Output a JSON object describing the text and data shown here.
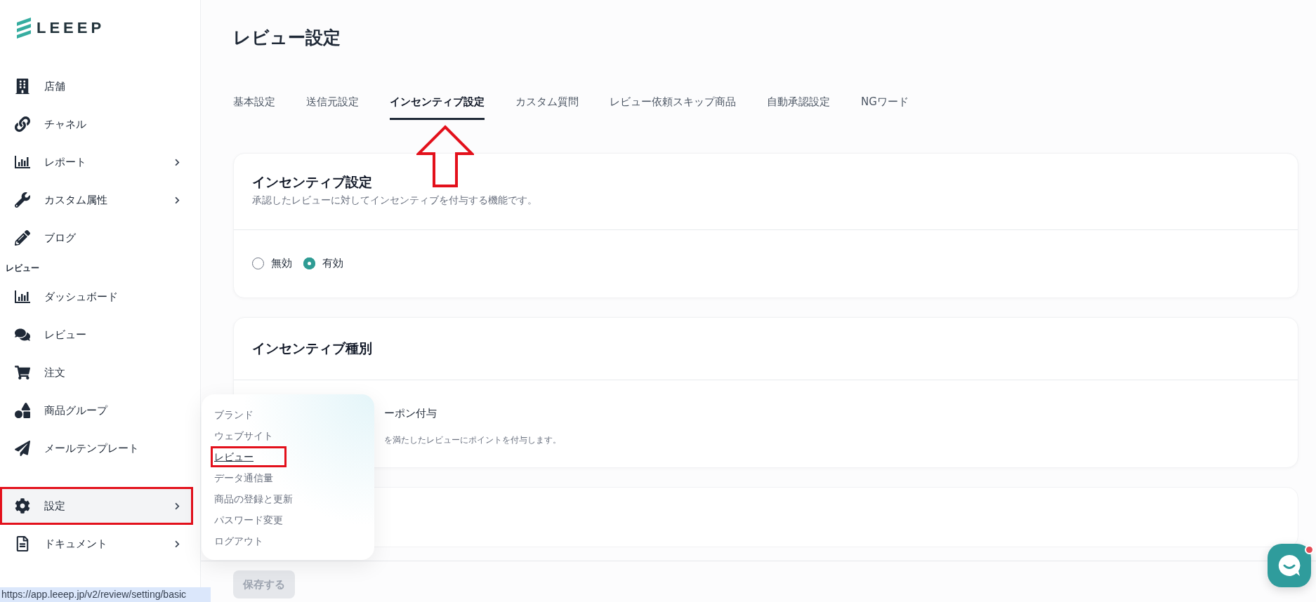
{
  "logo": {
    "text": "LEEEP"
  },
  "sidebar": {
    "items": [
      {
        "label": "店舗",
        "submenu": false,
        "selected": false,
        "marked": false
      },
      {
        "label": "チャネル",
        "submenu": false,
        "selected": false,
        "marked": false
      },
      {
        "label": "レポート",
        "submenu": true,
        "selected": false,
        "marked": false
      },
      {
        "label": "カスタム属性",
        "submenu": true,
        "selected": false,
        "marked": false
      },
      {
        "label": "ブログ",
        "submenu": false,
        "selected": false,
        "marked": false
      }
    ],
    "section_label": "レビュー",
    "review_items": [
      {
        "label": "ダッシュボード",
        "submenu": false,
        "selected": false,
        "marked": false
      },
      {
        "label": "レビュー",
        "submenu": false,
        "selected": false,
        "marked": false
      },
      {
        "label": "注文",
        "submenu": false,
        "selected": false,
        "marked": false
      },
      {
        "label": "商品グループ",
        "submenu": false,
        "selected": false,
        "marked": false
      },
      {
        "label": "メールテンプレート",
        "submenu": false,
        "selected": false,
        "marked": false
      }
    ],
    "bottom_items": [
      {
        "label": "設定",
        "submenu": true,
        "selected": true,
        "marked": true
      },
      {
        "label": "ドキュメント",
        "submenu": true,
        "selected": false,
        "marked": false
      }
    ]
  },
  "page_title": "レビュー設定",
  "tabs": [
    {
      "label": "基本設定",
      "selected": false
    },
    {
      "label": "送信元設定",
      "selected": false
    },
    {
      "label": "インセンティブ設定",
      "selected": true
    },
    {
      "label": "カスタム質問",
      "selected": false
    },
    {
      "label": "レビュー依頼スキップ商品",
      "selected": false
    },
    {
      "label": "自動承認設定",
      "selected": false
    },
    {
      "label": "NGワード",
      "selected": false
    }
  ],
  "incentive_card": {
    "title": "インセンティブ設定",
    "description": "承認したレビューに対してインセンティブを付与する機能です。",
    "options": [
      {
        "label": "無効",
        "selected": false
      },
      {
        "label": "有効",
        "selected": true
      }
    ]
  },
  "type_card": {
    "title": "インセンティブ種別",
    "option_label": "ーポン付与",
    "option_description": "を満たしたレビューにポイントを付与します。"
  },
  "save_button": {
    "label": "保存する",
    "disabled": true
  },
  "settings_menu": {
    "items": [
      {
        "label": "ブランド",
        "selected": false,
        "marked": false
      },
      {
        "label": "ウェブサイト",
        "selected": false,
        "marked": false
      },
      {
        "label": "レビュー",
        "selected": true,
        "marked": true
      },
      {
        "label": "データ通信量",
        "selected": false,
        "marked": false
      },
      {
        "label": "商品の登録と更新",
        "selected": false,
        "marked": false
      },
      {
        "label": "パスワード変更",
        "selected": false,
        "marked": false
      },
      {
        "label": "ログアウト",
        "selected": false,
        "marked": false
      }
    ]
  },
  "chat_button": {
    "unread": true
  },
  "status_url": "https://app.leeep.jp/v2/review/setting/basic"
}
